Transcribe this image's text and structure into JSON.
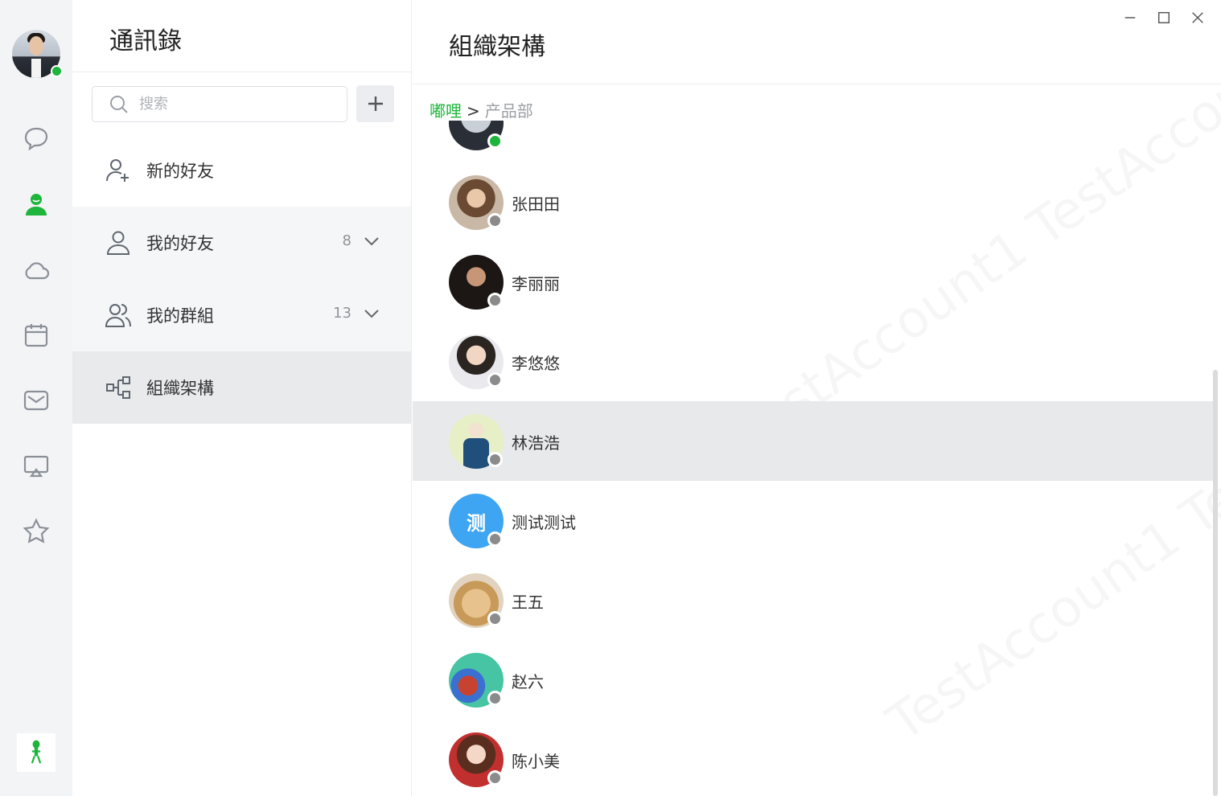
{
  "left_rail": {
    "user_status": "online",
    "nav_icons": [
      "chat-icon",
      "contacts-icon",
      "cloud-icon",
      "calendar-icon",
      "mail-icon",
      "screen-share-icon",
      "star-icon"
    ],
    "active_icon": "contacts-icon",
    "accent_color": "#1db53b"
  },
  "sidebar": {
    "title": "通訊錄",
    "search_placeholder": "搜索",
    "add_button_icon": "plus-icon",
    "items": [
      {
        "label": "新的好友",
        "icon": "add-friend-icon"
      },
      {
        "label": "我的好友",
        "icon": "friend-icon",
        "count": "8"
      },
      {
        "label": "我的群組",
        "icon": "group-icon",
        "count": "13"
      },
      {
        "label": "組織架構",
        "icon": "org-chart-icon"
      }
    ]
  },
  "main": {
    "title": "組織架構",
    "breadcrumb": {
      "root": "嘟哩",
      "separator": ">",
      "current": "产品部"
    },
    "contacts": [
      {
        "name": "",
        "status": "online"
      },
      {
        "name": "张田田",
        "status": "offline"
      },
      {
        "name": "李丽丽",
        "status": "offline"
      },
      {
        "name": "李悠悠",
        "status": "offline"
      },
      {
        "name": "林浩浩",
        "status": "offline",
        "selected": true
      },
      {
        "name": "测试测试",
        "status": "offline",
        "avatar_text": "测"
      },
      {
        "name": "王五",
        "status": "offline"
      },
      {
        "name": "赵六",
        "status": "offline"
      },
      {
        "name": "陈小美",
        "status": "offline"
      }
    ]
  }
}
